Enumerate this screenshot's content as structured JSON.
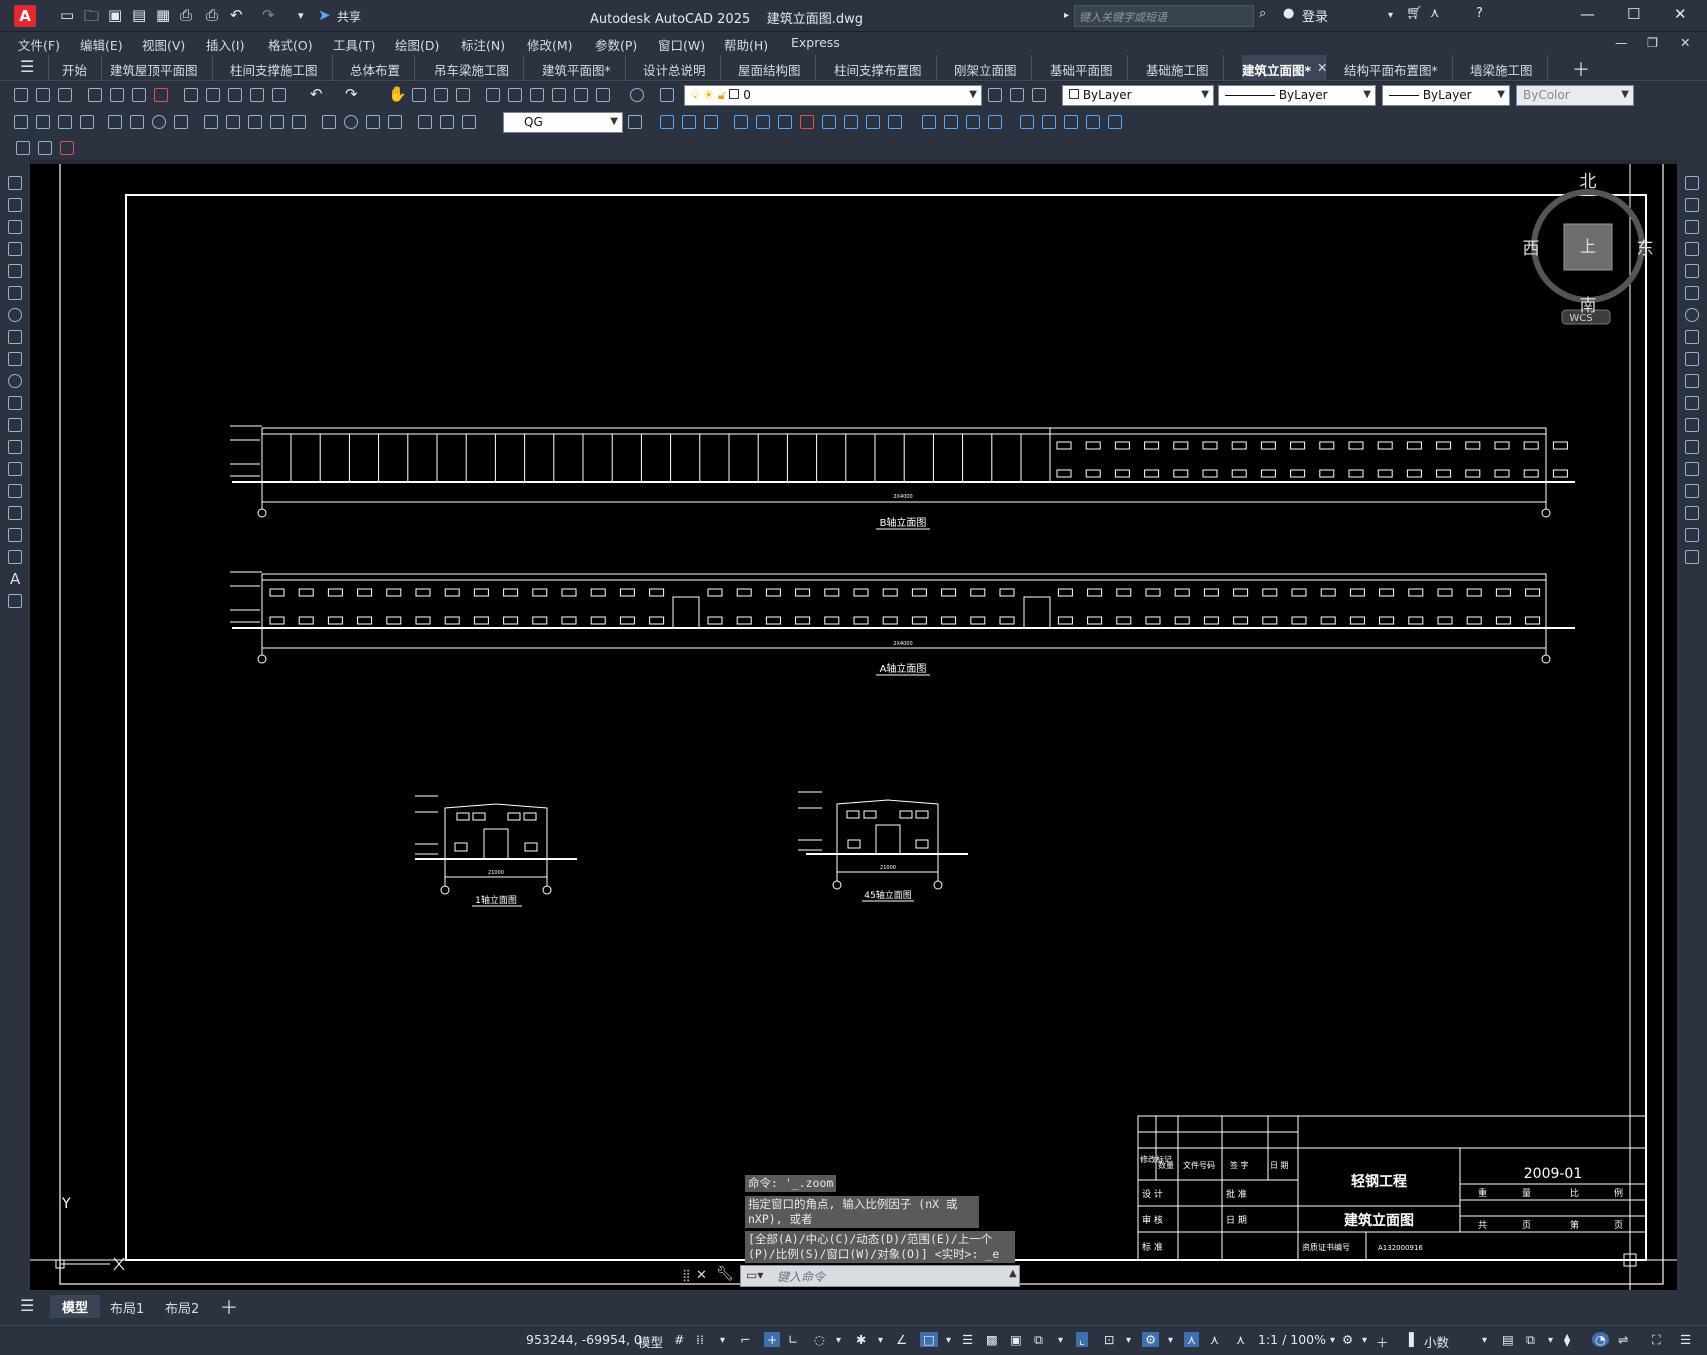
{
  "title_bar": {
    "logo": "A",
    "share": "共享",
    "app_title": "Autodesk AutoCAD 2025",
    "file_name": "建筑立面图.dwg",
    "search_placeholder": "键入关键字或短语",
    "login": "登录"
  },
  "menus": [
    "文件(F)",
    "编辑(E)",
    "视图(V)",
    "插入(I)",
    "格式(O)",
    "工具(T)",
    "绘图(D)",
    "标注(N)",
    "修改(M)",
    "参数(P)",
    "窗口(W)",
    "帮助(H)",
    "Express"
  ],
  "file_tabs": [
    "开始",
    "建筑屋顶平面图",
    "柱间支撑施工图",
    "总体布置",
    "吊车梁施工图",
    "建筑平面图*",
    "设计总说明",
    "屋面结构图",
    "柱间支撑布置图",
    "刚架立面图",
    "基础平面图",
    "基础施工图",
    "建筑立面图*",
    "结构平面布置图*",
    "墙梁施工图"
  ],
  "active_tab": "建筑立面图*",
  "layer": {
    "name": "0"
  },
  "properties": {
    "color": "ByLayer",
    "linetype": "ByLayer",
    "lineweight": "ByLayer",
    "plotstyle": "ByColor"
  },
  "dimstyle": "QG",
  "viewcube": {
    "north": "北",
    "south": "南",
    "east": "东",
    "west": "西",
    "face": "上",
    "wcs": "WCS"
  },
  "drawing": {
    "elev_b": "B轴立面图",
    "elev_a": "A轴立面图",
    "elev_1": "1轴立面图",
    "elev_45": "45轴立面图",
    "dim_long": "2X4000",
    "dim_short": "21000",
    "ucs_y": "Y",
    "title_block": {
      "headers": [
        "修改标记",
        "数量",
        "文件号码",
        "签 字",
        "日 期"
      ],
      "rows": [
        [
          "设 计",
          "批 准"
        ],
        [
          "审 核",
          "日 期"
        ],
        [
          "标 准",
          "资质证书编号"
        ]
      ],
      "project": "轻钢工程",
      "drawing_name": "建筑立面图",
      "date": "2009-01",
      "cert_no": "A132000916",
      "scale_headers": [
        "重",
        "量",
        "比",
        "例"
      ],
      "page_headers": [
        "共",
        "页",
        "第",
        "页"
      ]
    }
  },
  "command": {
    "history": [
      "命令: '_.zoom",
      "指定窗口的角点, 输入比例因子 (nX 或 nXP), 或者",
      "[全部(A)/中心(C)/动态(D)/范围(E)/上一个(P)/比例(S)/窗口(W)/对象(O)] <实时>: _e"
    ],
    "placeholder": "键入命令"
  },
  "layout_tabs": [
    "模型",
    "布局1",
    "布局2"
  ],
  "status": {
    "coords": "953244, -69954, 0",
    "space": "模型",
    "scale": "1:1 / 100%",
    "units": "小数"
  }
}
